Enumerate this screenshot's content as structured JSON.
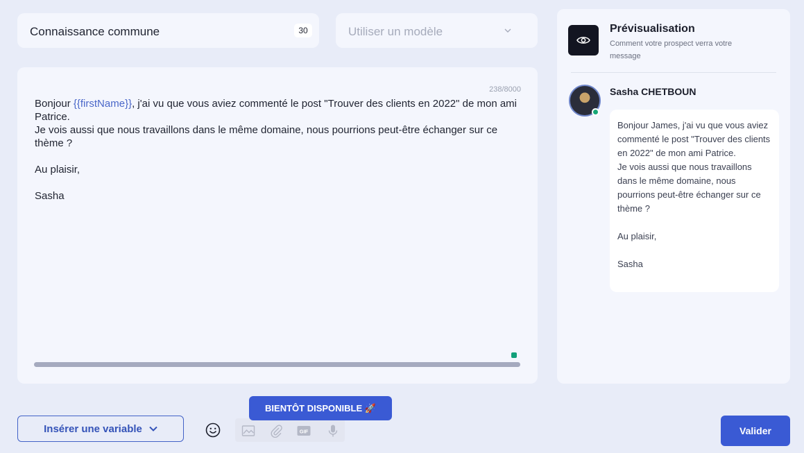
{
  "relation": {
    "value": "Connaissance commune",
    "count": "30"
  },
  "template": {
    "placeholder": "Utiliser un modèle"
  },
  "editor": {
    "char_count": "238/8000",
    "line1_before": "Bonjour ",
    "line1_variable": "{{firstName}}",
    "line1_after": ", j'ai vu que vous aviez commenté le post \"Trouver des clients en 2022\" de mon ami Patrice.\nJe vois aussi que nous travaillons dans le même domaine, nous pourrions peut-être échanger sur ce thème ?\n\nAu plaisir,\n\nSasha"
  },
  "preview": {
    "title": "Prévisualisation",
    "subtitle": "Comment votre prospect verra votre message",
    "sender": "Sasha CHETBOUN",
    "message": "Bonjour James, j'ai vu que vous aviez commenté le post \"Trouver des clients en 2022\" de mon ami Patrice.\nJe vois aussi que nous travaillons dans le même domaine, nous pourrions peut-être échanger sur ce thème ?\n\nAu plaisir,\n\nSasha"
  },
  "toolbar": {
    "insert_variable": "Insérer une variable",
    "coming_soon": "BIENTÔT DISPONIBLE 🚀",
    "gif_label": "GIF",
    "validate": "Valider"
  },
  "colors": {
    "accent": "#3a5ad4",
    "online": "#17a877",
    "variable": "#4a67c9"
  },
  "icons": [
    "chevron-down-icon",
    "eye-icon",
    "smiley-icon",
    "image-icon",
    "paperclip-icon",
    "gif-icon",
    "microphone-icon"
  ]
}
